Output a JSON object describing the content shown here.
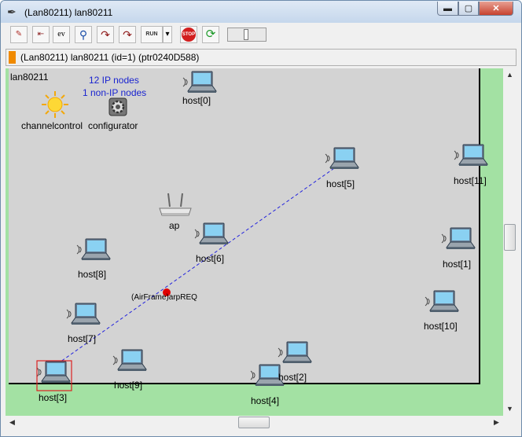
{
  "window": {
    "title": "(Lan80211) lan80211",
    "icon": "feather-icon"
  },
  "title_buttons": {
    "minimize": "▬",
    "maximize": "▢",
    "close": "✕"
  },
  "toolbar": {
    "buttons": [
      {
        "icon": "redraw-icon",
        "glyph": "✎"
      },
      {
        "icon": "find-object-icon",
        "glyph": "⇤"
      },
      {
        "icon": "event-log-icon",
        "glyph": "ev"
      },
      {
        "icon": "zoom-search-icon",
        "glyph": "⚲"
      },
      {
        "icon": "step-icon",
        "glyph": "↷"
      },
      {
        "icon": "step-fast-icon",
        "glyph": "↷"
      },
      {
        "icon": "run-icon",
        "glyph": "RUN"
      },
      {
        "icon": "dropdown-icon",
        "glyph": "▾"
      },
      {
        "icon": "stop-icon",
        "glyph": "STOP"
      },
      {
        "icon": "refresh-icon",
        "glyph": "⟳"
      }
    ]
  },
  "infobar": {
    "text": "(Lan80211) lan80211  (id=1)  (ptr0240D588)"
  },
  "canvas": {
    "network_name": "lan80211",
    "ip_nodes": "12 IP nodes",
    "non_ip_nodes": "1 non-IP nodes",
    "message_label": "(AirFrame)arpREQ",
    "colors": {
      "background": "#a3e1a3",
      "network": "#d3d3d3",
      "ipinfo": "#1a24d0",
      "link": "#2222dd",
      "message": "#e00000",
      "selection": "#dd2222"
    },
    "special_nodes": [
      {
        "name": "channelcontrol",
        "icon": "sun-icon"
      },
      {
        "name": "configurator",
        "icon": "gear-icon"
      },
      {
        "name": "ap",
        "icon": "access-point-icon"
      }
    ],
    "hosts": [
      "host[0]",
      "host[1]",
      "host[2]",
      "host[3]",
      "host[4]",
      "host[5]",
      "host[6]",
      "host[7]",
      "host[8]",
      "host[9]",
      "host[10]",
      "host[11]"
    ]
  },
  "scrollbars": {
    "up": "▲",
    "down": "▼",
    "left": "◀",
    "right": "▶"
  }
}
